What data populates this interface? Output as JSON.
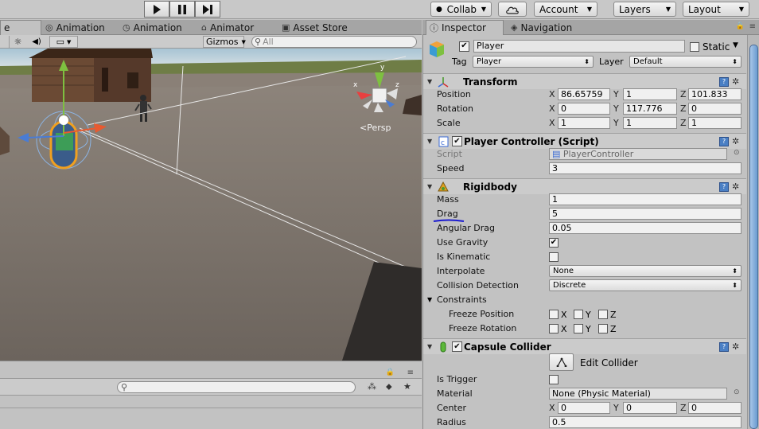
{
  "toolbar": {
    "collab": "Collab",
    "account": "Account",
    "layers": "Layers",
    "layout": "Layout"
  },
  "scene": {
    "tabs": [
      {
        "label": "e"
      },
      {
        "label": "Animation"
      },
      {
        "label": "Animation"
      },
      {
        "label": "Animator"
      },
      {
        "label": "Asset Store"
      }
    ],
    "gizmos_label": "Gizmos",
    "search_placeholder": "All",
    "persp_label": "Persp"
  },
  "inspector": {
    "tabs": [
      {
        "label": "Inspector"
      },
      {
        "label": "Navigation"
      }
    ],
    "object_name": "Player",
    "static_label": "Static",
    "tag_label": "Tag",
    "tag_value": "Player",
    "layer_label": "Layer",
    "layer_value": "Default",
    "transform": {
      "title": "Transform",
      "position": {
        "label": "Position",
        "x": "86.65759",
        "y": "1",
        "z": "101.833"
      },
      "rotation": {
        "label": "Rotation",
        "x": "0",
        "y": "117.776",
        "z": "0"
      },
      "scale": {
        "label": "Scale",
        "x": "1",
        "y": "1",
        "z": "1"
      }
    },
    "player_controller": {
      "title": "Player Controller (Script)",
      "script_label": "Script",
      "script_value": "PlayerController",
      "speed_label": "Speed",
      "speed_value": "3"
    },
    "rigidbody": {
      "title": "Rigidbody",
      "mass_label": "Mass",
      "mass_value": "1",
      "drag_label": "Drag",
      "drag_value": "5",
      "angular_drag_label": "Angular Drag",
      "angular_drag_value": "0.05",
      "use_gravity_label": "Use Gravity",
      "use_gravity_checked": true,
      "is_kinematic_label": "Is Kinematic",
      "is_kinematic_checked": false,
      "interpolate_label": "Interpolate",
      "interpolate_value": "None",
      "collision_label": "Collision Detection",
      "collision_value": "Discrete",
      "constraints_label": "Constraints",
      "freeze_position_label": "Freeze Position",
      "freeze_rotation_label": "Freeze Rotation",
      "axis_x": "X",
      "axis_y": "Y",
      "axis_z": "Z"
    },
    "capsule_collider": {
      "title": "Capsule Collider",
      "edit_label": "Edit Collider",
      "is_trigger_label": "Is Trigger",
      "is_trigger_checked": false,
      "material_label": "Material",
      "material_value": "None (Physic Material)",
      "center_label": "Center",
      "center_x": "0",
      "center_y": "0",
      "center_z": "0",
      "radius_label": "Radius",
      "radius_value": "0.5"
    }
  },
  "colors": {
    "accent_blue": "#4a7fc4",
    "annotation_underline": "#1a1ad0",
    "sky": "#b9cdd9",
    "ground": "#7d746c",
    "panel_bg": "#c2c2c2"
  }
}
